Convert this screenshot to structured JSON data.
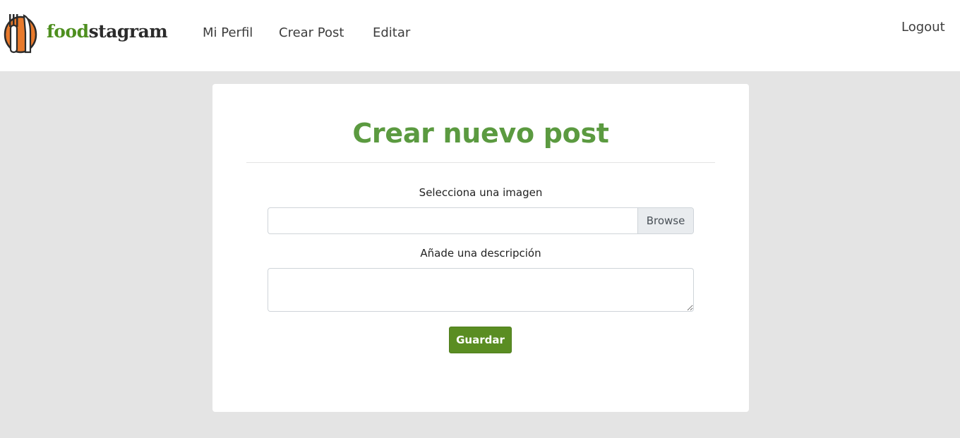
{
  "brand": {
    "name_part1": "food",
    "name_part2": "stagram",
    "logo_icon": "fork-knife-plate-icon",
    "colors": {
      "green": "#4e8f1f",
      "dark": "#2b2b2b",
      "orange": "#e87a2c"
    }
  },
  "nav": {
    "items": [
      {
        "label": "Mi Perfil"
      },
      {
        "label": "Crear Post"
      },
      {
        "label": "Editar"
      }
    ],
    "logout_label": "Logout"
  },
  "form": {
    "title": "Crear nuevo post",
    "image_label": "Selecciona una imagen",
    "file_value": "",
    "browse_label": "Browse",
    "description_label": "Añade una descripción",
    "description_value": "",
    "submit_label": "Guardar"
  },
  "colors": {
    "page_bg": "#e4e4e4",
    "title_green": "#5b9a40",
    "button_green": "#5a8d22"
  }
}
